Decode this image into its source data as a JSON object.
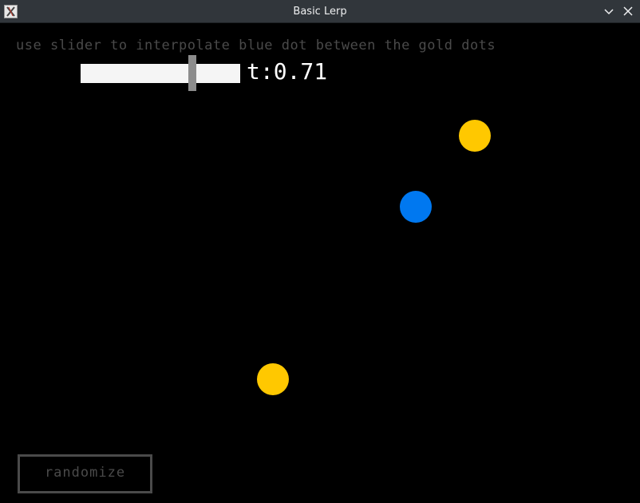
{
  "window": {
    "title": "Basic Lerp",
    "icon": "x11-app-icon",
    "minimize_icon": "chevron-down-icon",
    "close_icon": "close-icon"
  },
  "canvas": {
    "instruction": "use slider to interpolate blue dot between the gold dots",
    "slider": {
      "value": 0.71,
      "min": 0,
      "max": 1
    },
    "t_label": {
      "prefix": "t: ",
      "value": "0.71"
    },
    "randomize_label": "randomize"
  },
  "colors": {
    "background": "#000000",
    "gold": "#ffc800",
    "blue": "#0078f0",
    "dim_text": "#4a4a4a",
    "slider_track": "#f5f5f5",
    "slider_thumb": "#8c8c8c"
  }
}
